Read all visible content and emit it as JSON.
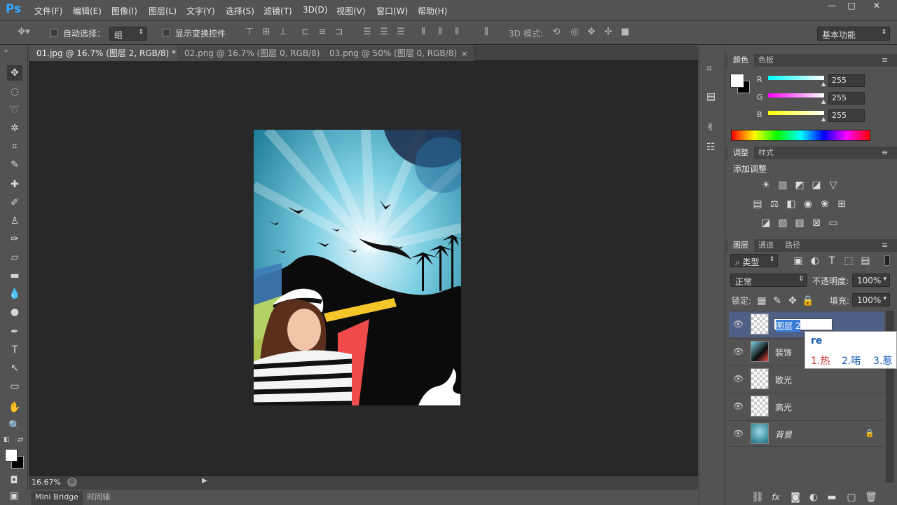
{
  "app": {
    "logo": "Ps"
  },
  "menu": [
    "文件(F)",
    "编辑(E)",
    "图像(I)",
    "图层(L)",
    "文字(Y)",
    "选择(S)",
    "滤镜(T)",
    "3D(D)",
    "视图(V)",
    "窗口(W)",
    "帮助(H)"
  ],
  "options": {
    "auto_select_label": "自动选择：",
    "auto_select_value": "组",
    "show_transform_label": "显示变换控件",
    "mode3d_label": "3D 模式:",
    "workspace": "基本功能"
  },
  "tabs": [
    {
      "label": "01.jpg @ 16.7% (图层 2, RGB/8) *",
      "close": "×"
    },
    {
      "label": "02.png @ 16.7% (图层 0, RGB/8)",
      "close": "×"
    },
    {
      "label": "03.png @ 50% (图层 0, RGB/8)",
      "close": "×"
    }
  ],
  "status": {
    "zoom": "16.67%"
  },
  "bottom_tabs": [
    "Mini Bridge",
    "时间轴"
  ],
  "color_panel": {
    "tabs": [
      "颜色",
      "色板"
    ],
    "channels": [
      {
        "label": "R",
        "value": "255",
        "color": "#00ffff"
      },
      {
        "label": "G",
        "value": "255",
        "color": "#ff00ff"
      },
      {
        "label": "B",
        "value": "255",
        "color": "#ffff00"
      }
    ]
  },
  "adjust_panel": {
    "tabs": [
      "调整",
      "样式"
    ],
    "title": "添加调整"
  },
  "layers_panel": {
    "tabs": [
      "图层",
      "通道",
      "路径"
    ],
    "filter": "类型",
    "blend_mode": "正常",
    "opacity_label": "不透明度:",
    "opacity_value": "100%",
    "lock_label": "锁定:",
    "fill_label": "填充:",
    "fill_value": "100%",
    "layers": [
      {
        "name": "图层 2",
        "editing": true
      },
      {
        "name": "装饰"
      },
      {
        "name": "散光"
      },
      {
        "name": "高光"
      },
      {
        "name": "背景",
        "locked": true
      }
    ]
  },
  "ime": {
    "input": "re",
    "candidates": [
      "1.热",
      "2.喏",
      "3.惹"
    ]
  }
}
